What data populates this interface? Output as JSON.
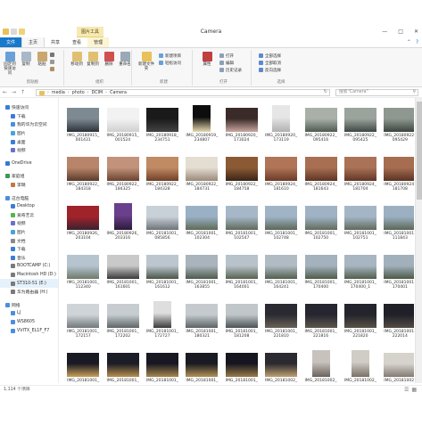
{
  "window": {
    "title": "Camera",
    "context_tab_group": "图片工具"
  },
  "ribbon_tabs": [
    {
      "label": "文件"
    },
    {
      "label": "主页"
    },
    {
      "label": "共享"
    },
    {
      "label": "查看"
    },
    {
      "label": "管理"
    }
  ],
  "ribbon": {
    "clipboard": {
      "label": "剪贴板",
      "pin": "固定到快速访问",
      "copy": "复制",
      "paste": "粘贴",
      "cut": "剪切",
      "copy_path": "复制路径",
      "paste_shortcut": "粘贴快捷方式"
    },
    "organize": {
      "label": "组织",
      "move_to": "移动到",
      "copy_to": "复制到",
      "delete": "删除",
      "rename": "重命名"
    },
    "new": {
      "label": "新建",
      "new_folder": "新建文件夹",
      "new_item": "新建项目",
      "easy_access": "轻松访问"
    },
    "open": {
      "label": "打开",
      "properties": "属性",
      "open": "打开",
      "edit": "编辑",
      "history": "历史记录"
    },
    "select": {
      "label": "选择",
      "select_all": "全部选择",
      "select_none": "全部取消",
      "invert": "反向选择"
    }
  },
  "address": {
    "segments": [
      "media",
      "photo",
      "DCIM",
      "Camera"
    ],
    "search_placeholder": "搜索\"Camera\""
  },
  "nav": {
    "items": [
      {
        "label": "快速访问",
        "level": 0,
        "color": "#3b7dd8"
      },
      {
        "label": "下载",
        "level": 1,
        "color": "#3b7dd8"
      },
      {
        "label": "我的华为云空间",
        "level": 1,
        "color": "#4a8fdf"
      },
      {
        "label": "图片",
        "level": 1,
        "color": "#4aa3d8"
      },
      {
        "label": "桌面",
        "level": 1,
        "color": "#3b7dd8"
      },
      {
        "label": "视频",
        "level": 1,
        "color": "#6a6fc8"
      },
      {
        "label": "OneDrive",
        "level": 0,
        "color": "#2f7ad6",
        "gap": true
      },
      {
        "label": "家庭组",
        "level": 0,
        "color": "#3a9a5a",
        "gap": true
      },
      {
        "label": "李璐",
        "level": 1,
        "color": "#c07a3c"
      },
      {
        "label": "这台电脑",
        "level": 0,
        "color": "#4a8fdf",
        "gap": true
      },
      {
        "label": "Desktop",
        "level": 1,
        "color": "#3b7dd8"
      },
      {
        "label": "爱奇艺云",
        "level": 1,
        "color": "#58b34a"
      },
      {
        "label": "视频",
        "level": 1,
        "color": "#6a6fc8"
      },
      {
        "label": "图片",
        "level": 1,
        "color": "#4aa3d8"
      },
      {
        "label": "文档",
        "level": 1,
        "color": "#8a8a8a"
      },
      {
        "label": "下载",
        "level": 1,
        "color": "#3b7dd8"
      },
      {
        "label": "音乐",
        "level": 1,
        "color": "#3b7dd8"
      },
      {
        "label": "BOOTCAMP (C:)",
        "level": 1,
        "color": "#7a7a7a"
      },
      {
        "label": "Macintosh HD (D:)",
        "level": 1,
        "color": "#7a7a7a"
      },
      {
        "label": "ST310-51 (E:)",
        "level": 1,
        "color": "#7a7a7a",
        "selected": true
      },
      {
        "label": "华为路由器 (H:)",
        "level": 1,
        "color": "#7a7a7a"
      },
      {
        "label": "网络",
        "level": 0,
        "color": "#4a8fdf",
        "gap": true
      },
      {
        "label": "LJ",
        "level": 1,
        "color": "#4a8fdf"
      },
      {
        "label": "WS8605",
        "level": 1,
        "color": "#4a8fdf"
      },
      {
        "label": "VVITX_EL1F_F7",
        "level": 1,
        "color": "#4a8fdf"
      }
    ]
  },
  "files": [
    {
      "line1": "IMG_20180915_",
      "line2": "001431",
      "c1": "#7d8a92",
      "c2": "#2b3238"
    },
    {
      "line1": "IMG_20180915_",
      "line2": "001524",
      "c1": "#f2f2f2",
      "c2": "#cfcfcf"
    },
    {
      "line1": "IMG_20180918_",
      "line2": "234751",
      "c1": "#1a1a1a",
      "c2": "#444444"
    },
    {
      "line1": "IMG_20180919_",
      "line2": "234807",
      "c1": "#0d0d0d",
      "c2": "#e8d9b0",
      "portrait": true
    },
    {
      "line1": "IMG_20180920_",
      "line2": "173024",
      "c1": "#3a2a28",
      "c2": "#c9a7a0"
    },
    {
      "line1": "IMG_20180920_",
      "line2": "173119",
      "c1": "#e6e6e6",
      "c2": "#b0b0b0",
      "portrait": true
    },
    {
      "line1": "IMG_20180922_",
      "line2": "095416",
      "c1": "#a8b0a8",
      "c2": "#4f5a52"
    },
    {
      "line1": "IMG_20180922_",
      "line2": "095425",
      "c1": "#9aa39c",
      "c2": "#3f4743"
    },
    {
      "line1": "IMG_20180922_",
      "line2": "095429",
      "c1": "#8f9890",
      "c2": "#3c443f"
    },
    {
      "line1": "IMG_20180922_",
      "line2": "184318",
      "c1": "#b8856a",
      "c2": "#5a3a2a"
    },
    {
      "line1": "IMG_20180922_",
      "line2": "184325",
      "c1": "#c2927a",
      "c2": "#6a4330"
    },
    {
      "line1": "IMG_20180922_",
      "line2": "184328",
      "c1": "#c08a63",
      "c2": "#704027"
    },
    {
      "line1": "IMG_20180922_",
      "line2": "184731",
      "c1": "#e4ddd2",
      "c2": "#9a8978"
    },
    {
      "line1": "IMG_20180922_",
      "line2": "184758",
      "c1": "#8b5a34",
      "c2": "#3a2418"
    },
    {
      "line1": "IMG_20180924_",
      "line2": "181610",
      "c1": "#b07456",
      "c2": "#6b3a28"
    },
    {
      "line1": "IMG_20180924_",
      "line2": "181643",
      "c1": "#a86f52",
      "c2": "#5e3424"
    },
    {
      "line1": "IMG_20180924_",
      "line2": "181704",
      "c1": "#aa7256",
      "c2": "#613627"
    },
    {
      "line1": "IMG_20180924_",
      "line2": "181708",
      "c1": "#a66d50",
      "c2": "#5a3223"
    },
    {
      "line1": "IMG_20180926_",
      "line2": "203104",
      "c1": "#a0232a",
      "c2": "#3a2230"
    },
    {
      "line1": "IMG_20180926_",
      "line2": "203316",
      "c1": "#6a3f8c",
      "c2": "#2a1b3a",
      "portrait": true
    },
    {
      "line1": "IMG_20181001_",
      "line2": "085856",
      "c1": "#c8d0d8",
      "c2": "#6d7378"
    },
    {
      "line1": "IMG_20181001_",
      "line2": "102304",
      "c1": "#9ab0c4",
      "c2": "#5e6b57"
    },
    {
      "line1": "IMG_20181001_",
      "line2": "102547",
      "c1": "#a6b8c8",
      "c2": "#5f6a5a"
    },
    {
      "line1": "IMG_20181001_",
      "line2": "102748",
      "c1": "#a0b4c6",
      "c2": "#5b6757"
    },
    {
      "line1": "IMG_20181001_",
      "line2": "102750",
      "c1": "#9fb3c5",
      "c2": "#616c5c"
    },
    {
      "line1": "IMG_20181001_",
      "line2": "102751",
      "c1": "#a4b6c6",
      "c2": "#5f6a5b"
    },
    {
      "line1": "IMG_20181001_",
      "line2": "111843",
      "c1": "#9cb0c2",
      "c2": "#5a6756"
    },
    {
      "line1": "IMG_20181001_",
      "line2": "112340",
      "c1": "#b6c4d0",
      "c2": "#6e7a6a"
    },
    {
      "line1": "IMG_20181001_",
      "line2": "161601",
      "c1": "#c9c9c9",
      "c2": "#3a3a3a"
    },
    {
      "line1": "IMG_20181001_",
      "line2": "161612",
      "c1": "#bcc6ce",
      "c2": "#4a5448"
    },
    {
      "line1": "IMG_20181001_",
      "line2": "163855",
      "c1": "#aab4bc",
      "c2": "#4e5a4c"
    },
    {
      "line1": "IMG_20181001_",
      "line2": "164001",
      "c1": "#b8c2ca",
      "c2": "#566250"
    },
    {
      "line1": "IMG_20181001_",
      "line2": "164241",
      "c1": "#b0bbc4",
      "c2": "#525e4e"
    },
    {
      "line1": "IMG_20181001_",
      "line2": "170400",
      "c1": "#a4b2be",
      "c2": "#4e5c4a"
    },
    {
      "line1": "IMG_20181001_",
      "line2": "170400_1",
      "c1": "#a8b6c2",
      "c2": "#505e4c"
    },
    {
      "line1": "IMG_20181001_",
      "line2": "170401",
      "c1": "#a2b0bc",
      "c2": "#4c5a48"
    },
    {
      "line1": "IMG_20181001_",
      "line2": "172157",
      "c1": "#cfd4d8",
      "c2": "#70787a"
    },
    {
      "line1": "IMG_20181001_",
      "line2": "172202",
      "c1": "#c6ccd0",
      "c2": "#5c6466"
    },
    {
      "line1": "IMG_20181001_",
      "line2": "172727",
      "c1": "#dedede",
      "c2": "#3a3a3a",
      "portrait": true
    },
    {
      "line1": "IMG_20181001_",
      "line2": "180321",
      "c1": "#c4cace",
      "c2": "#5a6264"
    },
    {
      "line1": "IMG_20181001_",
      "line2": "181208",
      "c1": "#c0c6ca",
      "c2": "#4a5254"
    },
    {
      "line1": "IMG_20181001_",
      "line2": "221810",
      "c1": "#2a2a32",
      "c2": "#6a6258"
    },
    {
      "line1": "IMG_20181001_",
      "line2": "221816",
      "c1": "#262630",
      "c2": "#5e574e"
    },
    {
      "line1": "IMG_20181001_",
      "line2": "221820",
      "c1": "#24242c",
      "c2": "#5a5248"
    },
    {
      "line1": "IMG_20181001_",
      "line2": "222014",
      "c1": "#202028",
      "c2": "#544c44"
    },
    {
      "line1": "IMG_20181001_",
      "line2": "",
      "c1": "#1a1a24",
      "c2": "#c9a05a"
    },
    {
      "line1": "IMG_20181001_",
      "line2": "",
      "c1": "#1c1c26",
      "c2": "#b89050"
    },
    {
      "line1": "IMG_20181001_",
      "line2": "",
      "c1": "#181822",
      "c2": "#a8884e"
    },
    {
      "line1": "IMG_20181001_",
      "line2": "",
      "c1": "#1a1a22",
      "c2": "#b49256"
    },
    {
      "line1": "IMG_20181001_",
      "line2": "",
      "c1": "#161620",
      "c2": "#9a7c48"
    },
    {
      "line1": "IMG_20181002_",
      "line2": "",
      "c1": "#2a2a30",
      "c2": "#c0a070"
    },
    {
      "line1": "IMG_20181002_",
      "line2": "",
      "c1": "#c8c2bc",
      "c2": "#6a625c",
      "portrait": true
    },
    {
      "line1": "IMG_20181002_",
      "line2": "",
      "c1": "#d0ccc6",
      "c2": "#7a7068",
      "portrait": true
    },
    {
      "line1": "IMG_20181002_",
      "line2": "",
      "c1": "#d6d2cc",
      "c2": "#847a72"
    }
  ],
  "status": {
    "count": "1,114 个项目"
  }
}
